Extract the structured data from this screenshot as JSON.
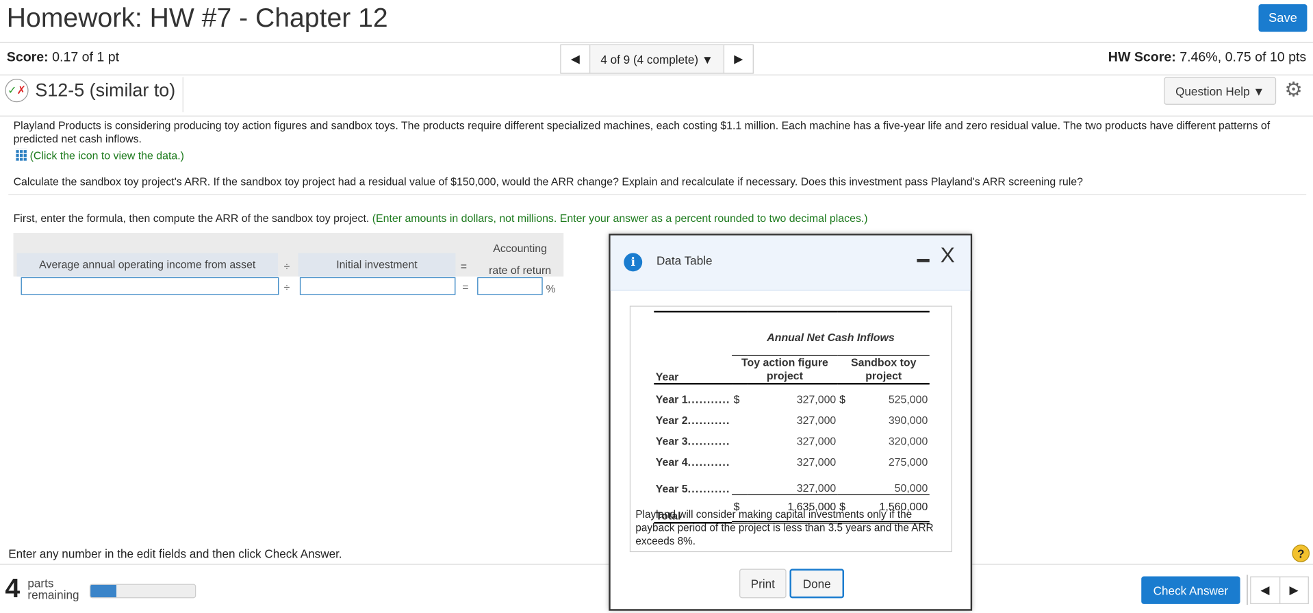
{
  "header": {
    "title": "Homework: HW #7 - Chapter 12",
    "save_label": "Save"
  },
  "score_bar": {
    "score_label": "Score:",
    "score_value": "0.17 of 1 pt",
    "nav_text": "4 of 9 (4 complete)",
    "hw_score_label": "HW Score:",
    "hw_score_value": "7.46%, 0.75 of 10 pts"
  },
  "question": {
    "id": "S12-5 (similar to)",
    "help_label": "Question Help"
  },
  "body": {
    "intro": "Playland Products is considering producing toy action figures and sandbox toys. The products require different specialized machines, each costing $1.1 million. Each machine has a five-year life and zero residual value. The two products have different patterns of predicted net cash inflows.",
    "data_link": "(Click the icon to view the data.)",
    "prompt": "Calculate the sandbox toy project's ARR. If the sandbox toy project had a residual value of $150,000, would the ARR change? Explain and recalculate if necessary. Does this investment pass Playland's ARR screening rule?",
    "instruction": "First, enter the formula, then compute the ARR of the sandbox toy project.",
    "instruction_hint": "(Enter amounts in dollars, not millions. Enter your answer as a percent rounded to two decimal places.)"
  },
  "formula": {
    "col1": "Average annual operating income from asset",
    "op1": "÷",
    "col2": "Initial investment",
    "op2": "=",
    "col3_line1": "Accounting",
    "col3_line2": "rate of return",
    "unit": "%",
    "input1": "",
    "input2": "",
    "input3": ""
  },
  "footer": {
    "hint": "Enter any number in the edit fields and then click Check Answer.",
    "parts_count": "4",
    "parts_label1": "parts",
    "parts_label2": "remaining",
    "progress_fraction": 0.25,
    "check_label": "Check Answer"
  },
  "dialog": {
    "title": "Data Table",
    "minimize": "-",
    "close": "X",
    "table_title": "Annual Net Cash Inflows",
    "col_year": "Year",
    "col_toy": "Toy action figure project",
    "col_sandbox": "Sandbox toy project",
    "rows": [
      {
        "year": "Year 1",
        "toy_sign": "$",
        "toy": "327,000",
        "sb_sign": "$",
        "sb": "525,000"
      },
      {
        "year": "Year 2",
        "toy_sign": "",
        "toy": "327,000",
        "sb_sign": "",
        "sb": "390,000"
      },
      {
        "year": "Year 3",
        "toy_sign": "",
        "toy": "327,000",
        "sb_sign": "",
        "sb": "320,000"
      },
      {
        "year": "Year 4",
        "toy_sign": "",
        "toy": "327,000",
        "sb_sign": "",
        "sb": "275,000"
      },
      {
        "year": "Year 5",
        "toy_sign": "",
        "toy": "327,000",
        "sb_sign": "",
        "sb": "50,000"
      }
    ],
    "total": {
      "label": "Total",
      "toy_sign": "$",
      "toy": "1,635,000",
      "sb_sign": "$",
      "sb": "1,560,000"
    },
    "note": "Playland will consider making capital investments only if the payback period of the project is less than 3.5 years and the ARR exceeds 8%.",
    "print_label": "Print",
    "done_label": "Done"
  },
  "colors": {
    "accent": "#1a7ccf",
    "hint_green": "#1c7a1c"
  }
}
